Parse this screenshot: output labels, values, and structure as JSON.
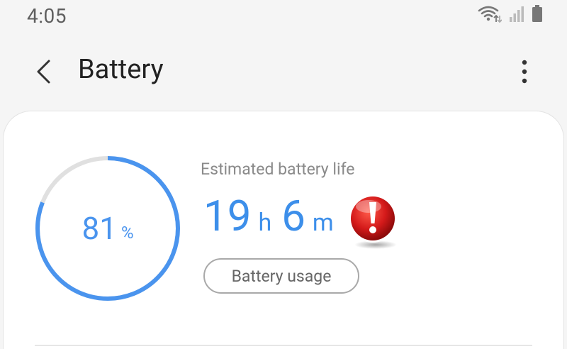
{
  "status_bar": {
    "time": "4:05",
    "icons": [
      "wifi-icon",
      "signal-icon",
      "battery-icon"
    ]
  },
  "app_bar": {
    "title": "Battery",
    "back_icon": "back-arrow-icon",
    "more_icon": "more-vert-icon"
  },
  "battery": {
    "percent_value": "81",
    "percent_unit": "%",
    "level_fraction": 0.81,
    "estimated_label": "Estimated battery life",
    "hours_value": "19",
    "hours_unit": "h",
    "minutes_value": "6",
    "minutes_unit": "m",
    "usage_button_label": "Battery usage",
    "warning_icon": "warning-exclamation-icon"
  },
  "colors": {
    "accent": "#4a94ee",
    "ring_track": "#e0e0e0",
    "warning": "#d41a1a"
  }
}
